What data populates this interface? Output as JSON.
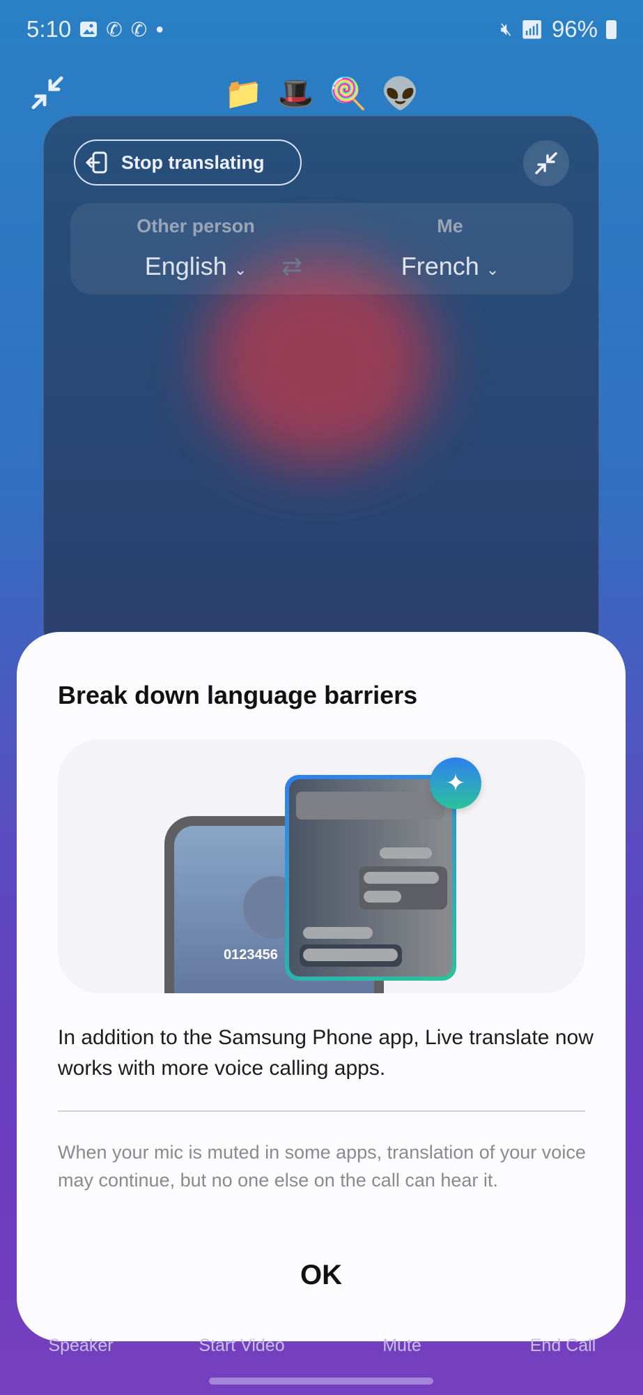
{
  "status_bar": {
    "time": "5:10",
    "battery": "96%",
    "icons": [
      "gallery-icon",
      "call-icon",
      "call-icon",
      "dot-icon",
      "mute-icon",
      "wifi-icon",
      "signal-icon",
      "battery-icon"
    ]
  },
  "overlay_emojis": [
    "📁",
    "🎩",
    "🍭",
    "👽"
  ],
  "translator": {
    "stop_label": "Stop translating",
    "other_label": "Other person",
    "other_lang": "English",
    "me_label": "Me",
    "me_lang": "French"
  },
  "dialog": {
    "title": "Break down language barriers",
    "illustration_number": "0123456",
    "body": "In addition to the Samsung Phone app, Live translate now works with more voice calling apps.",
    "note": "When your mic is muted in some apps, translation of your voice may continue, but no one else on the call can hear it.",
    "ok_label": "OK"
  },
  "call_controls": [
    "Speaker",
    "Start Video",
    "Mute",
    "End Call"
  ],
  "colors": {
    "accent_gradient_start": "#2f7ff0",
    "accent_gradient_end": "#2bc39a"
  }
}
